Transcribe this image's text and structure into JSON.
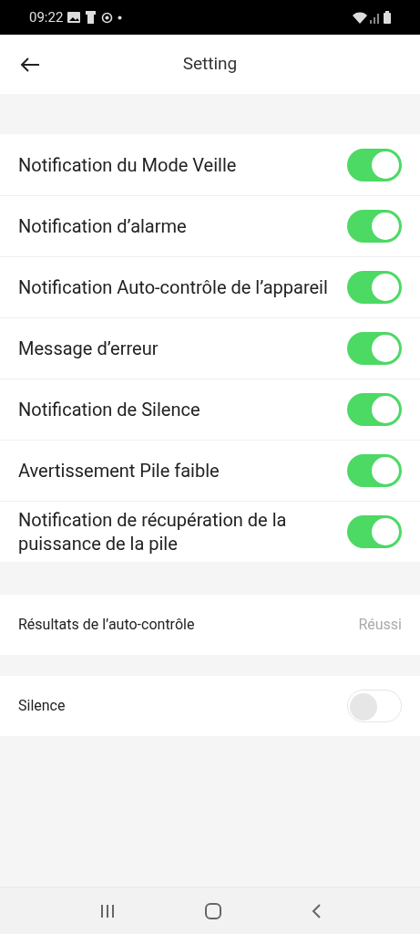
{
  "status_bar": {
    "time": "09:22"
  },
  "header": {
    "title": "Setting"
  },
  "notifications": [
    {
      "label": "Notification du Mode Veille",
      "on": true
    },
    {
      "label": "Notification d’alarme",
      "on": true
    },
    {
      "label": "Notification Auto-contrôle de l’appareil",
      "on": true
    },
    {
      "label": "Message d’erreur",
      "on": true
    },
    {
      "label": "Notification de Silence",
      "on": true
    },
    {
      "label": "Avertissement Pile faible",
      "on": true
    },
    {
      "label": "Notification de récupération de la puissance de la pile",
      "on": true
    }
  ],
  "self_test": {
    "label": "Résultats de l’auto-contrôle",
    "value": "Réussi"
  },
  "silence": {
    "label": "Silence",
    "on": false
  }
}
